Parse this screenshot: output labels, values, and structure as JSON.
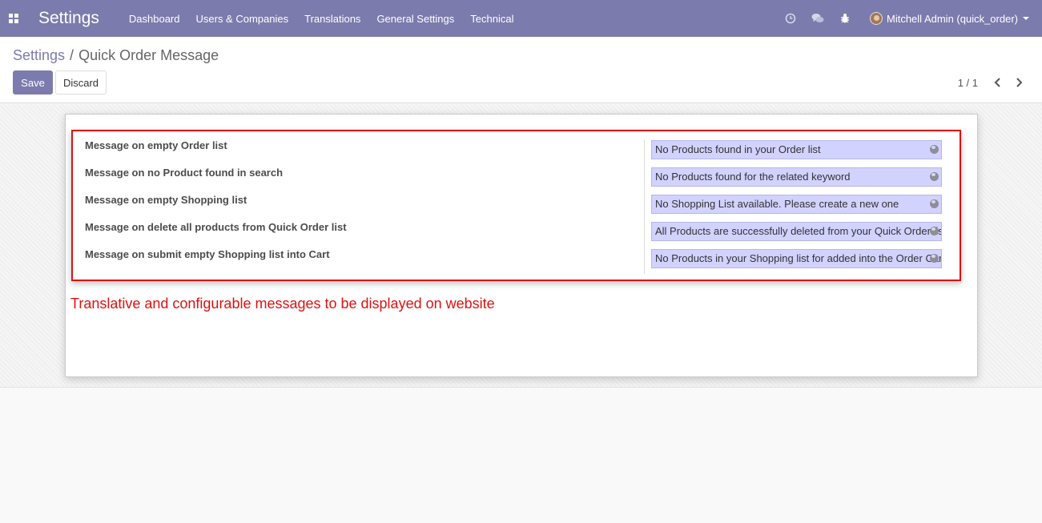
{
  "navbar": {
    "brand": "Settings",
    "menu": [
      "Dashboard",
      "Users & Companies",
      "Translations",
      "General Settings",
      "Technical"
    ],
    "user": "Mitchell Admin (quick_order)"
  },
  "breadcrumb": {
    "parent": "Settings",
    "separator": "/",
    "current": "Quick Order Message"
  },
  "buttons": {
    "save": "Save",
    "discard": "Discard"
  },
  "pager": {
    "value": "1 / 1"
  },
  "form": {
    "fields": [
      {
        "label": "Message on empty Order list",
        "value": "No Products found in your Order list"
      },
      {
        "label": "Message on no Product found in search",
        "value": "No Products found for the related keyword"
      },
      {
        "label": "Message on empty Shopping list",
        "value": "No Shopping List available. Please create a new one"
      },
      {
        "label": "Message on delete all products from Quick Order list",
        "value": "All Products are successfully deleted from your Quick Order list"
      },
      {
        "label": "Message on submit empty Shopping list into Cart",
        "value": "No Products in your Shopping list for added into the Order Cart"
      }
    ]
  },
  "annotation": "Translative and configurable messages to be displayed on website",
  "colors": {
    "brand": "#7c7bad",
    "field_bg": "#d2d2ff",
    "highlight": "#dd1111"
  },
  "icons": {
    "apps": "apps-grid-icon",
    "activity": "clock-icon",
    "messages": "chat-icon",
    "debug": "bug-icon",
    "translate": "globe-icon",
    "prev": "chevron-left-icon",
    "next": "chevron-right-icon"
  }
}
